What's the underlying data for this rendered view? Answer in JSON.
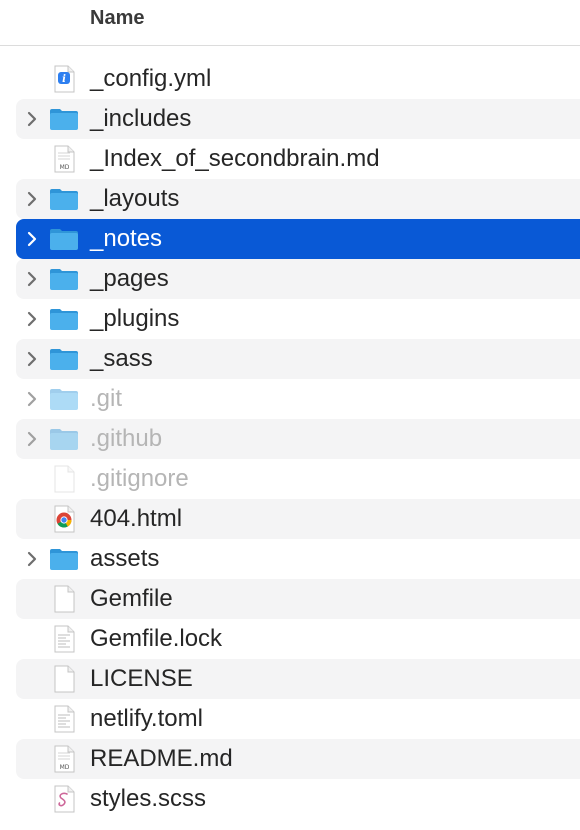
{
  "header": {
    "name_label": "Name"
  },
  "files": [
    {
      "name": "_config.yml",
      "kind": "yml",
      "expandable": false,
      "dimmed": false,
      "selected": false
    },
    {
      "name": "_includes",
      "kind": "folder",
      "expandable": true,
      "dimmed": false,
      "selected": false
    },
    {
      "name": "_Index_of_secondbrain.md",
      "kind": "md",
      "expandable": false,
      "dimmed": false,
      "selected": false
    },
    {
      "name": "_layouts",
      "kind": "folder",
      "expandable": true,
      "dimmed": false,
      "selected": false
    },
    {
      "name": "_notes",
      "kind": "folder",
      "expandable": true,
      "dimmed": false,
      "selected": true
    },
    {
      "name": "_pages",
      "kind": "folder",
      "expandable": true,
      "dimmed": false,
      "selected": false
    },
    {
      "name": "_plugins",
      "kind": "folder",
      "expandable": true,
      "dimmed": false,
      "selected": false
    },
    {
      "name": "_sass",
      "kind": "folder",
      "expandable": true,
      "dimmed": false,
      "selected": false
    },
    {
      "name": ".git",
      "kind": "folder",
      "expandable": true,
      "dimmed": true,
      "selected": false
    },
    {
      "name": ".github",
      "kind": "folder",
      "expandable": true,
      "dimmed": true,
      "selected": false
    },
    {
      "name": ".gitignore",
      "kind": "blank",
      "expandable": false,
      "dimmed": true,
      "selected": false
    },
    {
      "name": "404.html",
      "kind": "html",
      "expandable": false,
      "dimmed": false,
      "selected": false
    },
    {
      "name": "assets",
      "kind": "folder",
      "expandable": true,
      "dimmed": false,
      "selected": false
    },
    {
      "name": "Gemfile",
      "kind": "blank",
      "expandable": false,
      "dimmed": false,
      "selected": false
    },
    {
      "name": "Gemfile.lock",
      "kind": "text",
      "expandable": false,
      "dimmed": false,
      "selected": false
    },
    {
      "name": "LICENSE",
      "kind": "blank",
      "expandable": false,
      "dimmed": false,
      "selected": false
    },
    {
      "name": "netlify.toml",
      "kind": "text",
      "expandable": false,
      "dimmed": false,
      "selected": false
    },
    {
      "name": "README.md",
      "kind": "md",
      "expandable": false,
      "dimmed": false,
      "selected": false
    },
    {
      "name": "styles.scss",
      "kind": "scss",
      "expandable": false,
      "dimmed": false,
      "selected": false
    }
  ],
  "icons": {
    "folder": "folder-icon",
    "yml": "yml-file-icon",
    "md": "markdown-file-icon",
    "blank": "document-icon",
    "text": "text-file-icon",
    "html": "chrome-html-file-icon",
    "scss": "scss-file-icon",
    "chevron": "chevron-right-icon"
  },
  "colors": {
    "selection": "#0959d6",
    "alt_row": "#f4f4f5",
    "folder": "#3aa5e6",
    "dimmed_text": "#b5b5b5"
  },
  "md_badge": "MD"
}
